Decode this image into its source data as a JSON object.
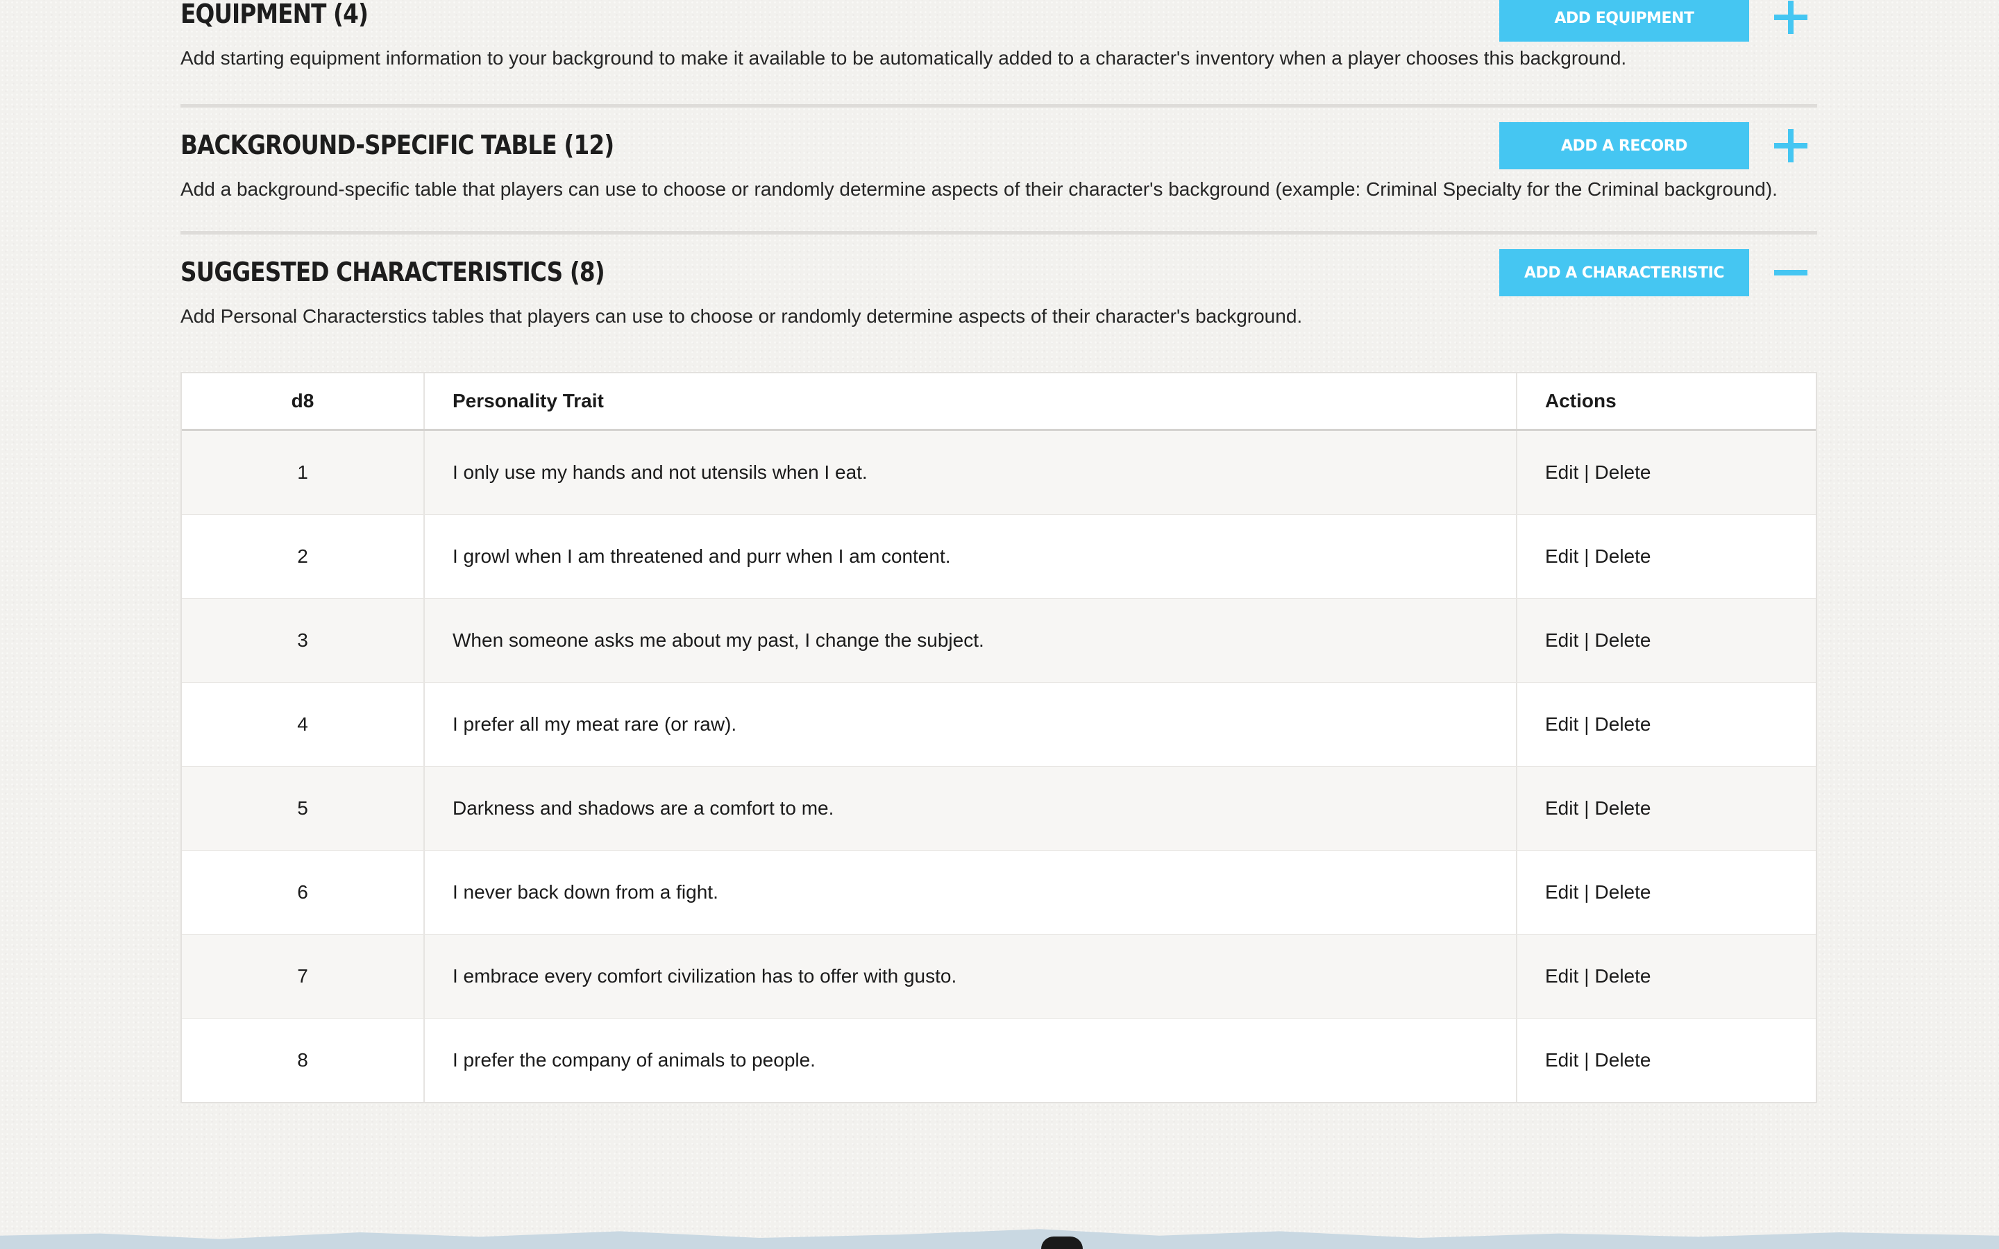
{
  "sections": {
    "equipment": {
      "title": "EQUIPMENT (4)",
      "description": "Add starting equipment information to your background to make it available to be automatically added to a character's inventory when a player chooses this background.",
      "button_label": "ADD EQUIPMENT",
      "toggle": "plus-icon"
    },
    "background_table": {
      "title": "BACKGROUND-SPECIFIC TABLE (12)",
      "description": "Add a background-specific table that players can use to choose or randomly determine aspects of their character's background (example: Criminal Specialty for the Criminal background).",
      "button_label": "ADD A RECORD",
      "toggle": "plus-icon"
    },
    "characteristics": {
      "title": "SUGGESTED CHARACTERISTICS (8)",
      "description": "Add Personal Characterstics tables that players can use to choose or randomly determine aspects of their character's background.",
      "button_label": "ADD A CHARACTERISTIC",
      "toggle": "minus-icon"
    }
  },
  "table": {
    "headers": [
      "d8",
      "Personality Trait",
      "Actions"
    ],
    "edit_label": "Edit",
    "separator": "|",
    "delete_label": "Delete",
    "rows": [
      {
        "roll": "1",
        "trait": "I only use my hands and not utensils when I eat."
      },
      {
        "roll": "2",
        "trait": "I growl when I am threatened and purr when I am content."
      },
      {
        "roll": "3",
        "trait": "When someone asks me about my past, I change the subject."
      },
      {
        "roll": "4",
        "trait": "I prefer all my meat rare (or raw)."
      },
      {
        "roll": "5",
        "trait": "Darkness and shadows are a comfort to me."
      },
      {
        "roll": "6",
        "trait": "I never back down from a fight."
      },
      {
        "roll": "7",
        "trait": "I embrace every comfort civilization has to offer with gusto."
      },
      {
        "roll": "8",
        "trait": "I prefer the company of animals to people."
      }
    ]
  },
  "colors": {
    "accent": "#45c6f2",
    "background": "#f2f1ee",
    "row_alt": "#f7f6f4"
  }
}
